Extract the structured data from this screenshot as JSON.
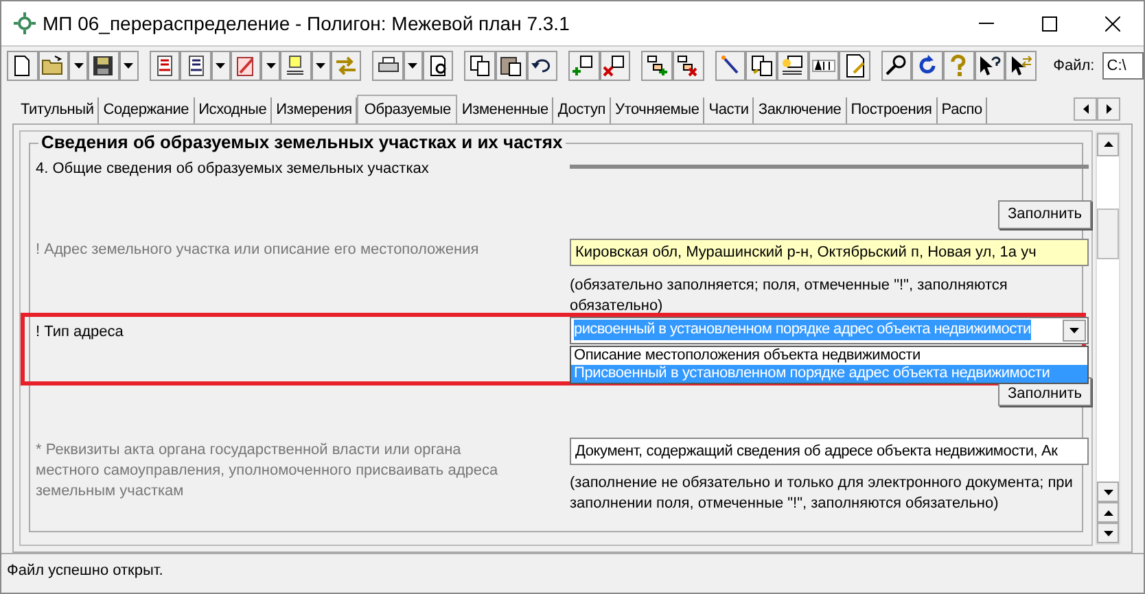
{
  "window": {
    "title": "МП 06_перераспределение - Полигон: Межевой план 7.3.1"
  },
  "toolbar": {
    "file_label": "Файл:",
    "file_value": "C:\\"
  },
  "tabs": [
    {
      "label": "Титульный",
      "selected": false
    },
    {
      "label": "Содержание",
      "selected": false
    },
    {
      "label": "Исходные",
      "selected": false
    },
    {
      "label": "Измерения",
      "selected": false
    },
    {
      "label": "Образуемые",
      "selected": true
    },
    {
      "label": "Измененные",
      "selected": false
    },
    {
      "label": "Доступ",
      "selected": false
    },
    {
      "label": "Уточняемые",
      "selected": false
    },
    {
      "label": "Части",
      "selected": false
    },
    {
      "label": "Заключение",
      "selected": false
    },
    {
      "label": "Построения",
      "selected": false
    },
    {
      "label": "Распо",
      "selected": false
    }
  ],
  "group": {
    "title": "Сведения об образуемых земельных участках и их частях",
    "section": "4. Общие сведения об образуемых земельных участках",
    "fill_button": "Заполнить",
    "address": {
      "label": "! Адрес земельного участка или описание его местоположения",
      "value": "Кировская обл, Мурашинский р-н, Октябрьский п, Новая ул, 1а уч",
      "note": "(обязательно заполняется; поля, отмеченные \"!\", заполняются обязательно)"
    },
    "address_type": {
      "label": "! Тип адреса",
      "value": "рисвоенный в установленном порядке адрес объекта недвижимости",
      "highlighted": true,
      "options": [
        {
          "label": "Описание местоположения объекта недвижимости",
          "selected": false
        },
        {
          "label": "Присвоенный в установленном порядке адрес объекта недвижимости",
          "selected": true
        }
      ],
      "fill_button": "Заполнить"
    },
    "act": {
      "label": "* Реквизиты акта органа государственной власти или органа местного самоуправления, уполномоченного присваивать адреса земельным участкам",
      "value": "Документ, содержащий сведения об адресе объекта недвижимости, Ак",
      "note": "(заполнение не обязательно и только для электронного документа; при заполнении поля, отмеченные \"!\", заполняются обязательно)"
    }
  },
  "status_bar": {
    "text": "Файл успешно открыт."
  }
}
